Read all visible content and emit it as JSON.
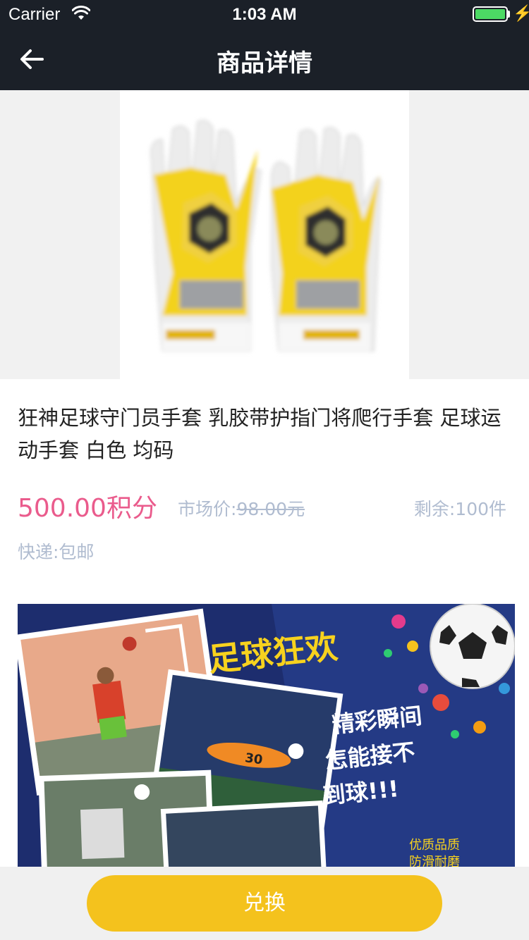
{
  "status_bar": {
    "carrier": "Carrier",
    "time": "1:03 AM",
    "battery_level": 1.0,
    "battery_color": "#4cd964"
  },
  "nav": {
    "title": "商品详情",
    "back_icon": "arrow-left-icon"
  },
  "product": {
    "name": "狂神足球守门员手套 乳胶带护指门将爬行手套 足球运动手套 白色 均码",
    "price": "500.00积分",
    "market_price_label": "市场价:",
    "market_price_value": "98.00元",
    "stock": "剩余:100件",
    "shipping": "快递:包邮",
    "price_color": "#ea5b8c"
  },
  "banner": {
    "headline": "足球狂欢",
    "slogan_line1": "精彩瞬间",
    "slogan_line2": "怎能接不",
    "slogan_line3": "到球!!!",
    "tag_line1": "优质品质",
    "tag_line2": "防滑耐磨",
    "jersey_number": "30"
  },
  "footer": {
    "redeem_label": "兑换",
    "button_color": "#f4c21d"
  }
}
